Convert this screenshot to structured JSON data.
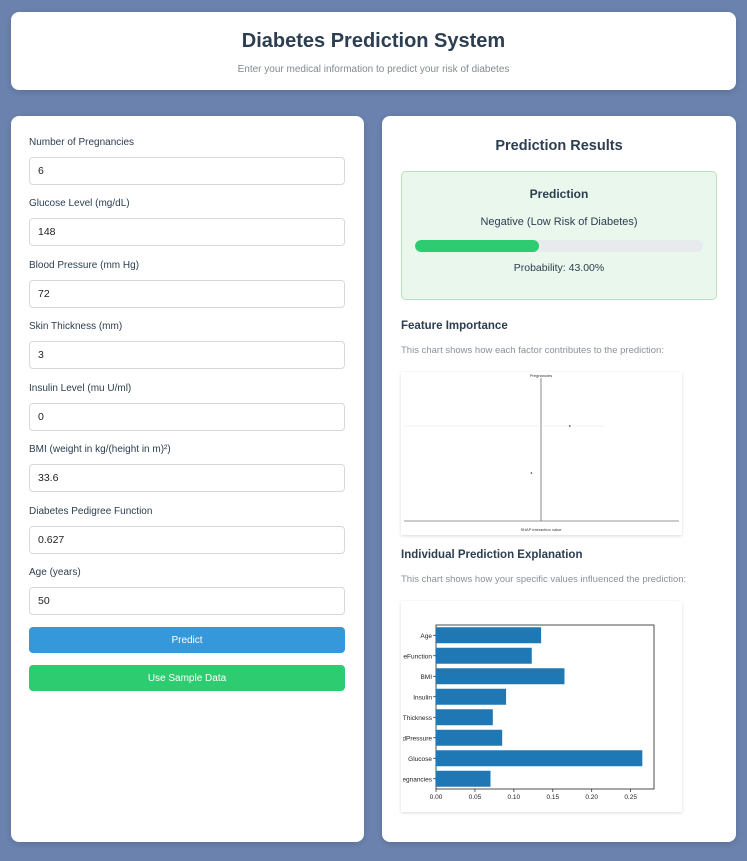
{
  "header": {
    "title": "Diabetes Prediction System",
    "subtitle": "Enter your medical information to predict your risk of diabetes"
  },
  "form": {
    "fields": [
      {
        "label": "Number of Pregnancies",
        "value": "6"
      },
      {
        "label": "Glucose Level (mg/dL)",
        "value": "148"
      },
      {
        "label": "Blood Pressure (mm Hg)",
        "value": "72"
      },
      {
        "label": "Skin Thickness (mm)",
        "value": "3"
      },
      {
        "label": "Insulin Level (mu U/ml)",
        "value": "0"
      },
      {
        "label": "BMI (weight in kg/(height in m)²)",
        "value": "33.6"
      },
      {
        "label": "Diabetes Pedigree Function",
        "value": "0.627"
      },
      {
        "label": "Age (years)",
        "value": "50"
      }
    ],
    "predict_label": "Predict",
    "sample_label": "Use Sample Data"
  },
  "results": {
    "title": "Prediction Results",
    "prediction_heading": "Prediction",
    "prediction_text": "Negative (Low Risk of Diabetes)",
    "probability_value": 0.43,
    "probability_text": "Probability: 43.00%",
    "feature_heading": "Feature Importance",
    "feature_desc": "This chart shows how each factor contributes to the prediction:",
    "explain_heading": "Individual Prediction Explanation",
    "explain_desc": "This chart shows how your specific values influenced the prediction:"
  },
  "colors": {
    "primary": "#3498db",
    "success": "#2ecc71",
    "bar": "#1f77b4",
    "background": "#6a82ad"
  },
  "chart_data": [
    {
      "type": "scatter",
      "note_top_label": "Pregnancies",
      "xlabel": "SHAP interaction value",
      "points": [
        {
          "x": 0.012,
          "y": 1
        },
        {
          "x": -0.004,
          "y": 2
        }
      ]
    },
    {
      "type": "bar",
      "orientation": "horizontal",
      "categories": [
        "Pregnancies",
        "Glucose",
        "BloodPressure",
        "SkinThickness",
        "Insulin",
        "BMI",
        "DiabetesPedigreeFunction",
        "Age"
      ],
      "tick_labels": [
        "egnancies",
        "Glucose",
        "odPressure",
        "Thickness",
        "Insulin",
        "BMI",
        "eeFunction",
        "Age"
      ],
      "values": [
        0.07,
        0.265,
        0.085,
        0.073,
        0.09,
        0.165,
        0.123,
        0.135
      ],
      "xlim": [
        0,
        0.28
      ],
      "xticks": [
        0.0,
        0.05,
        0.1,
        0.15,
        0.2,
        0.25
      ],
      "xtick_labels": [
        "0.00",
        "0.05",
        "0.10",
        "0.15",
        "0.20",
        "0.25"
      ]
    }
  ]
}
